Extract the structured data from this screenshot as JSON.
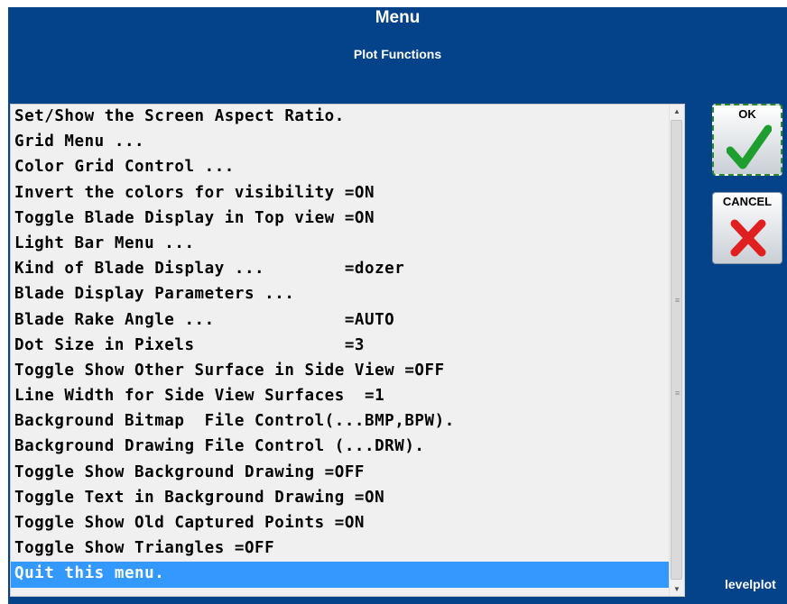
{
  "header": {
    "title": "Menu",
    "subtitle": "Plot Functions"
  },
  "menu": {
    "items": [
      "Set/Show the Screen Aspect Ratio.",
      "Grid Menu ...",
      "Color Grid Control ...",
      "Invert the colors for visibility =ON",
      "Toggle Blade Display in Top view =ON",
      "Light Bar Menu ...",
      "Kind of Blade Display ...        =dozer",
      "Blade Display Parameters ...",
      "Blade Rake Angle ...             =AUTO",
      "Dot Size in Pixels               =3",
      "Toggle Show Other Surface in Side View =OFF",
      "Line Width for Side View Surfaces  =1",
      "Background Bitmap  File Control(...BMP,BPW).",
      "Background Drawing File Control (...DRW).",
      "Toggle Show Background Drawing =OFF",
      "Toggle Text in Background Drawing =ON",
      "Toggle Show Old Captured Points =ON",
      "Toggle Show Triangles =OFF",
      "Quit this menu."
    ],
    "selected_index": 18
  },
  "buttons": {
    "ok_label": "OK",
    "cancel_label": "CANCEL"
  },
  "footer": {
    "brand": "levelplot"
  },
  "colors": {
    "background": "#04428a",
    "selection": "#3399ff",
    "ok_check": "#1e9e2e",
    "cancel_x": "#e02020"
  },
  "icons": {
    "ok": "check-icon",
    "cancel": "x-icon"
  }
}
